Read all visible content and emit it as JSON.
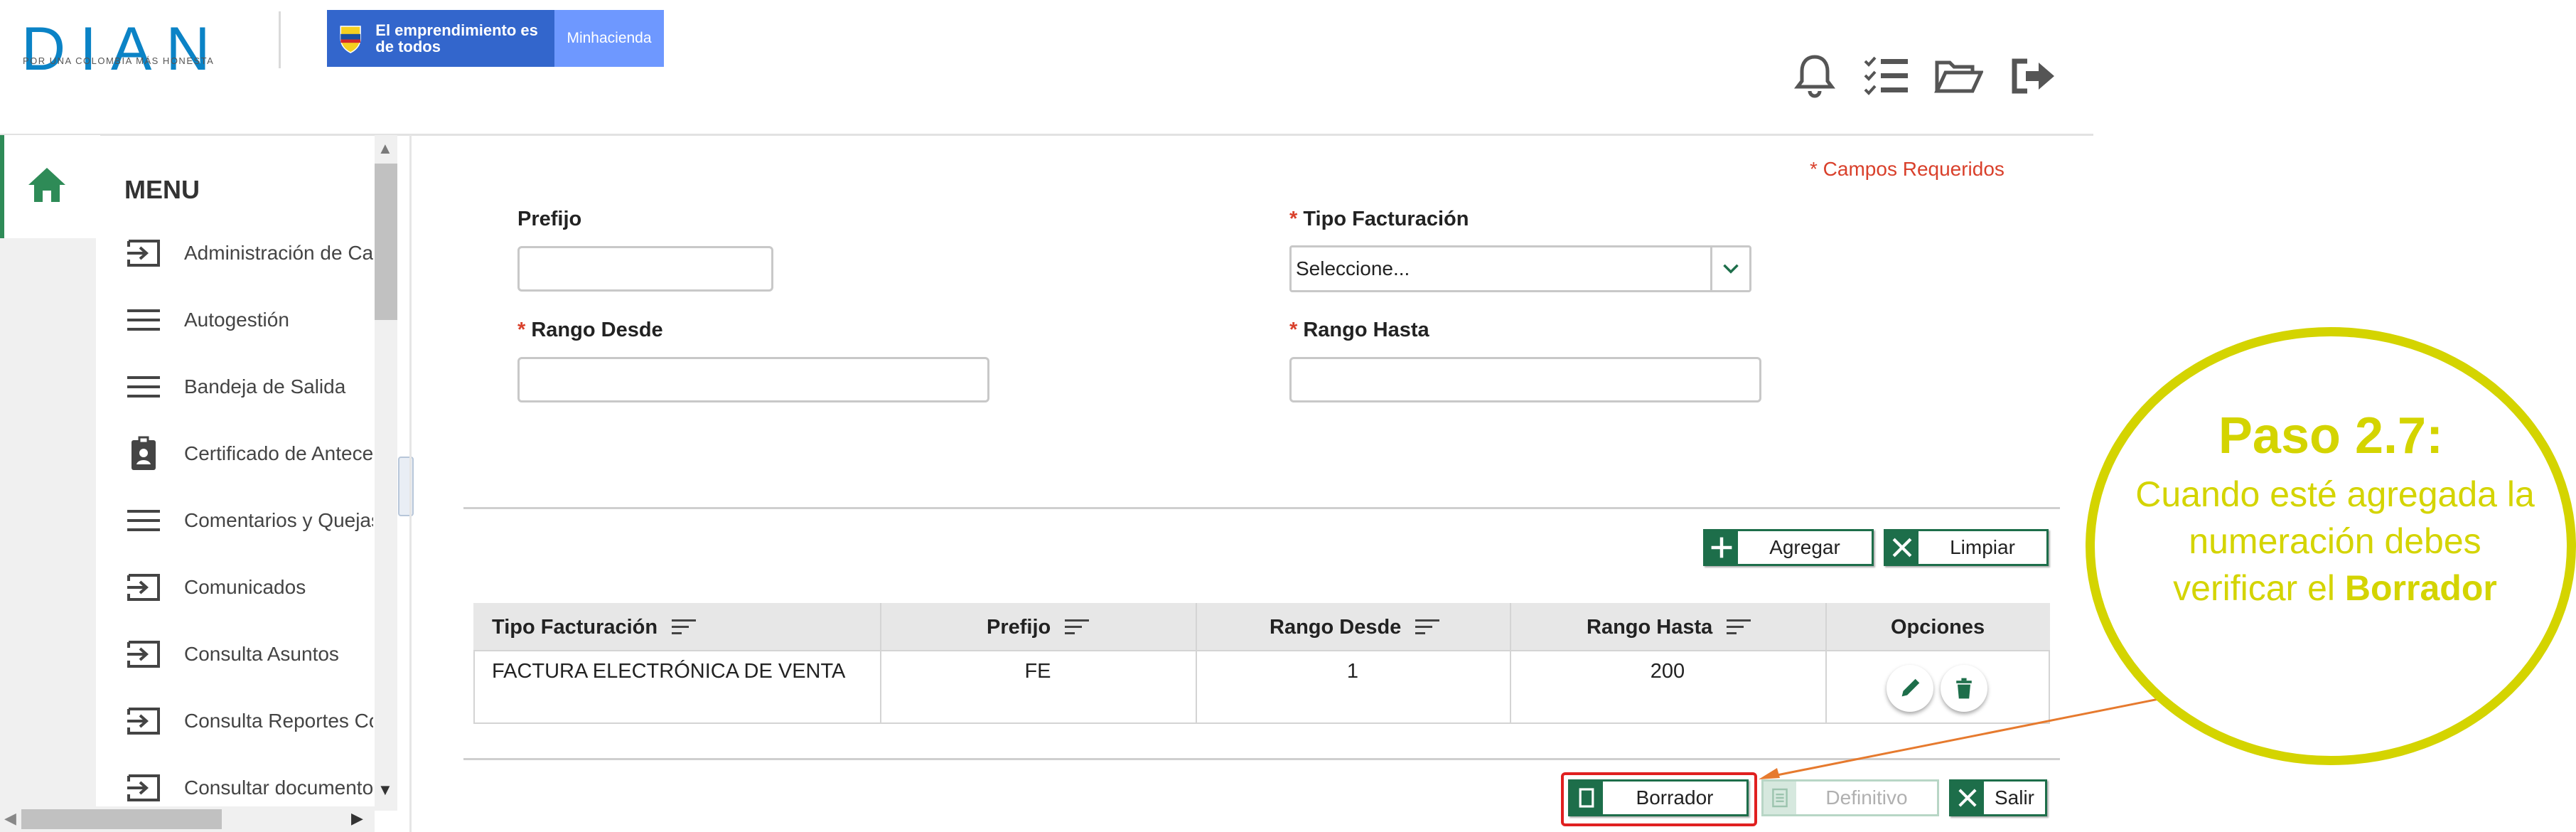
{
  "header": {
    "logo_word": "DIAN",
    "logo_slogan": "POR UNA COLOMBIA MÁS HONESTA",
    "gov_banner_text": "El emprendimiento es de todos",
    "gov_banner_ministry": "Minhacienda",
    "icons": [
      "bell-icon",
      "checklist-icon",
      "folder-open-icon",
      "logout-icon"
    ]
  },
  "sidebar": {
    "title": "MENU",
    "items": [
      {
        "label": "Administración de Ca",
        "icon": "sign-in-icon"
      },
      {
        "label": "Autogestión",
        "icon": "menu-lines-icon"
      },
      {
        "label": "Bandeja de Salida",
        "icon": "menu-lines-icon"
      },
      {
        "label": "Certificado de Antece",
        "icon": "id-badge-icon"
      },
      {
        "label": "Comentarios y Quejas",
        "icon": "menu-lines-icon"
      },
      {
        "label": "Comunicados",
        "icon": "sign-in-icon"
      },
      {
        "label": "Consulta Asuntos",
        "icon": "sign-in-icon"
      },
      {
        "label": "Consulta Reportes Co",
        "icon": "sign-in-icon"
      },
      {
        "label": "Consultar documento",
        "icon": "sign-in-icon"
      }
    ]
  },
  "form": {
    "required_note": "* Campos Requeridos",
    "prefijo_label": "Prefijo",
    "prefijo_value": "",
    "tipo_label": "Tipo Facturación",
    "tipo_value": "Seleccione...",
    "rango_desde_label": "Rango Desde",
    "rango_desde_value": "",
    "rango_hasta_label": "Rango Hasta",
    "rango_hasta_value": "",
    "required_star": "*"
  },
  "actions": {
    "agregar": "Agregar",
    "limpiar": "Limpiar",
    "borrador": "Borrador",
    "definitivo": "Definitivo",
    "salir": "Salir"
  },
  "table": {
    "headers": [
      "Tipo Facturación",
      "Prefijo",
      "Rango Desde",
      "Rango Hasta",
      "Opciones"
    ],
    "rows": [
      [
        "FACTURA ELECTRÓNICA DE VENTA",
        "FE",
        "1",
        "200"
      ]
    ]
  },
  "callout": {
    "title": "Paso 2.7:",
    "body_prefix": "Cuando esté agregada la numeración debes verificar el",
    "body_bold": "Borrador"
  },
  "colors": {
    "primary_green": "#1d6e4a",
    "dian_blue": "#0b83c6",
    "required_red": "#d9402b",
    "callout_yellow": "#d4d400",
    "highlight_red": "#e02020"
  }
}
